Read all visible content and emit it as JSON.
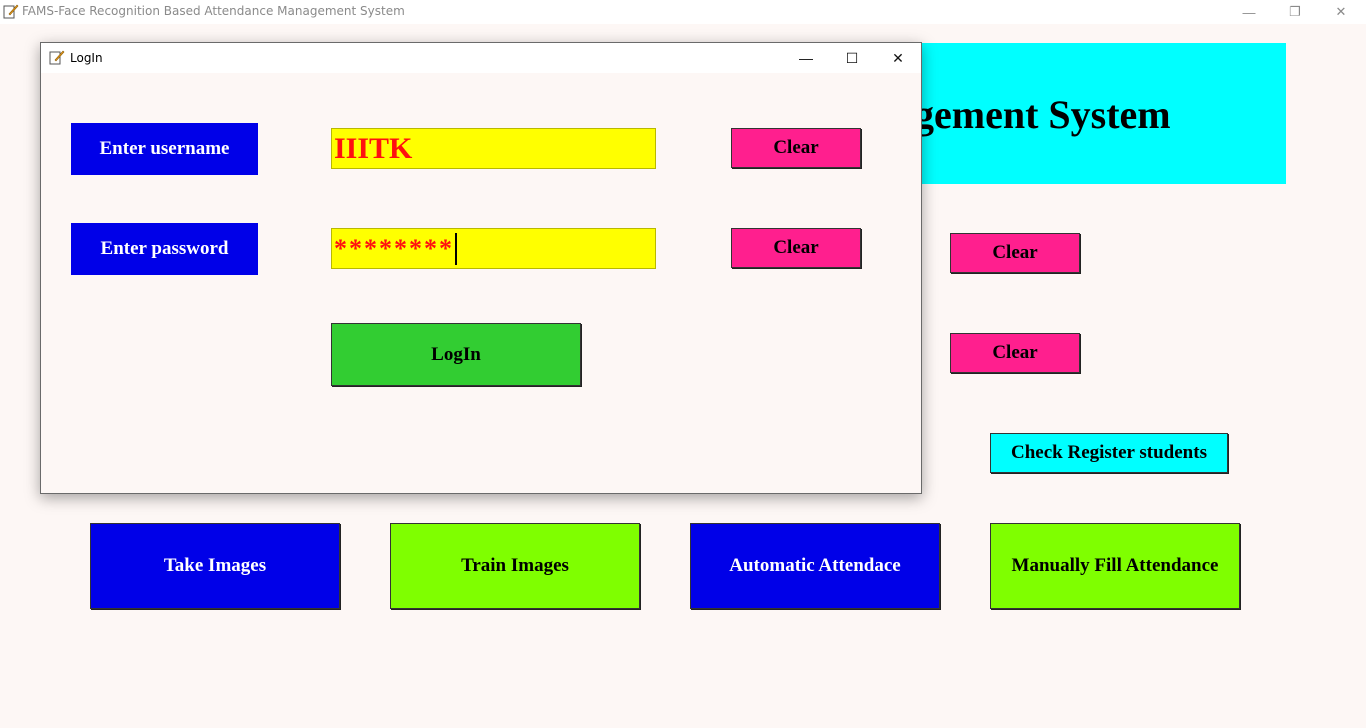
{
  "main_window": {
    "title": "FAMS-Face Recognition Based Attendance Management System",
    "heading_visible": "gement System",
    "controls": {
      "minimize": "—",
      "restore": "❐",
      "close": "✕"
    },
    "clear_buttons": [
      "Clear",
      "Clear"
    ],
    "check_register_label": "Check Register students",
    "action_buttons": [
      "Take Images",
      "Train Images",
      "Automatic Attendace",
      "Manually Fill Attendance"
    ]
  },
  "login_dialog": {
    "title": "LogIn",
    "controls": {
      "minimize": "—",
      "maximize": "☐",
      "close": "✕"
    },
    "username_label": "Enter username",
    "username_value": "IIITK",
    "password_label": "Enter password",
    "password_value": "********",
    "clear_username_label": "Clear",
    "clear_password_label": "Clear",
    "login_label": "LogIn"
  },
  "colors": {
    "background": "#fdf7f5",
    "banner": "#00ffff",
    "label_blue": "#0000e8",
    "entry_yellow": "#ffff00",
    "entry_text_red": "#ff1010",
    "clear_pink": "#ff1f8e",
    "login_green": "#32cd32",
    "action_lime": "#7fff00"
  }
}
